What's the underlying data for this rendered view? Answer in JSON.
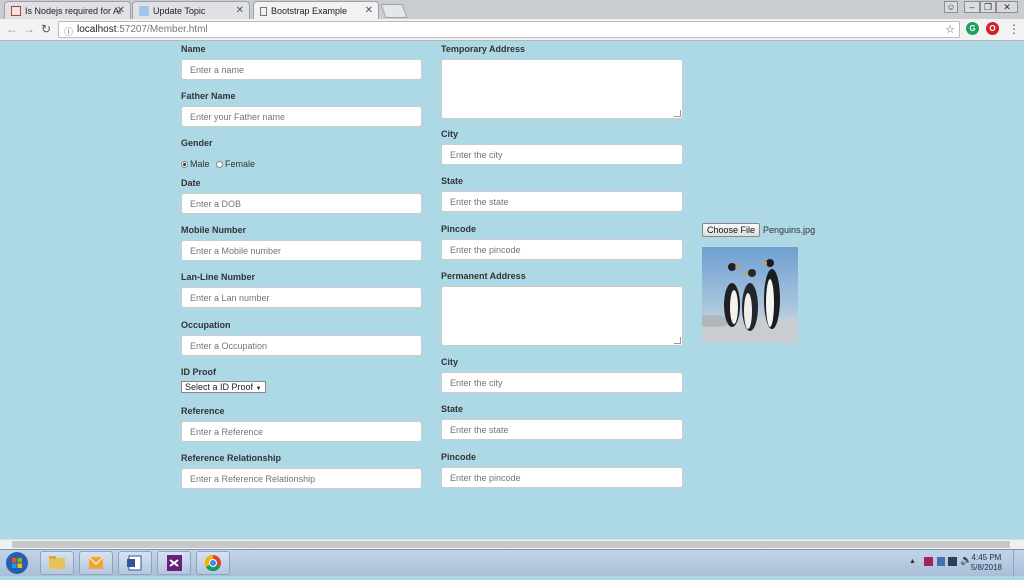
{
  "browser": {
    "tabs": [
      {
        "title": "Is Nodejs required for An",
        "active": false
      },
      {
        "title": "Update Topic",
        "active": false
      },
      {
        "title": "Bootstrap Example",
        "active": true
      }
    ],
    "url_host": "localhost",
    "url_path": ":57207/Member.html",
    "ext_g": "G",
    "ext_o": "O"
  },
  "form": {
    "name": {
      "label": "Name",
      "placeholder": "Enter a name"
    },
    "father": {
      "label": "Father Name",
      "placeholder": "Enter your Father name"
    },
    "gender": {
      "label": "Gender",
      "male": "Male",
      "female": "Female",
      "selected": "Male"
    },
    "date": {
      "label": "Date",
      "placeholder": "Enter a DOB"
    },
    "mobile": {
      "label": "Mobile Number",
      "placeholder": "Enter a Mobile number"
    },
    "landline": {
      "label": "Lan-Line Number",
      "placeholder": "Enter a Lan number"
    },
    "occupation": {
      "label": "Occupation",
      "placeholder": "Enter a Occupation"
    },
    "idproof": {
      "label": "ID Proof",
      "selected": "Select a ID Proof"
    },
    "reference": {
      "label": "Reference",
      "placeholder": "Enter a Reference"
    },
    "relationship": {
      "label": "Reference Relationship",
      "placeholder": "Enter a Reference Relationship"
    },
    "temp_address": {
      "label": "Temporary Address"
    },
    "temp_city": {
      "label": "City",
      "placeholder": "Enter the city"
    },
    "temp_state": {
      "label": "State",
      "placeholder": "Enter the state"
    },
    "temp_pincode": {
      "label": "Pincode",
      "placeholder": "Enter the pincode"
    },
    "perm_address": {
      "label": "Permanent Address"
    },
    "perm_city": {
      "label": "City",
      "placeholder": "Enter the city"
    },
    "perm_state": {
      "label": "State",
      "placeholder": "Enter the state"
    },
    "perm_pincode": {
      "label": "Pincode",
      "placeholder": "Enter the pincode"
    },
    "file": {
      "button": "Choose File",
      "filename": "Penguins.jpg"
    }
  },
  "taskbar": {
    "time": "4:45 PM",
    "date": "5/8/2018"
  }
}
